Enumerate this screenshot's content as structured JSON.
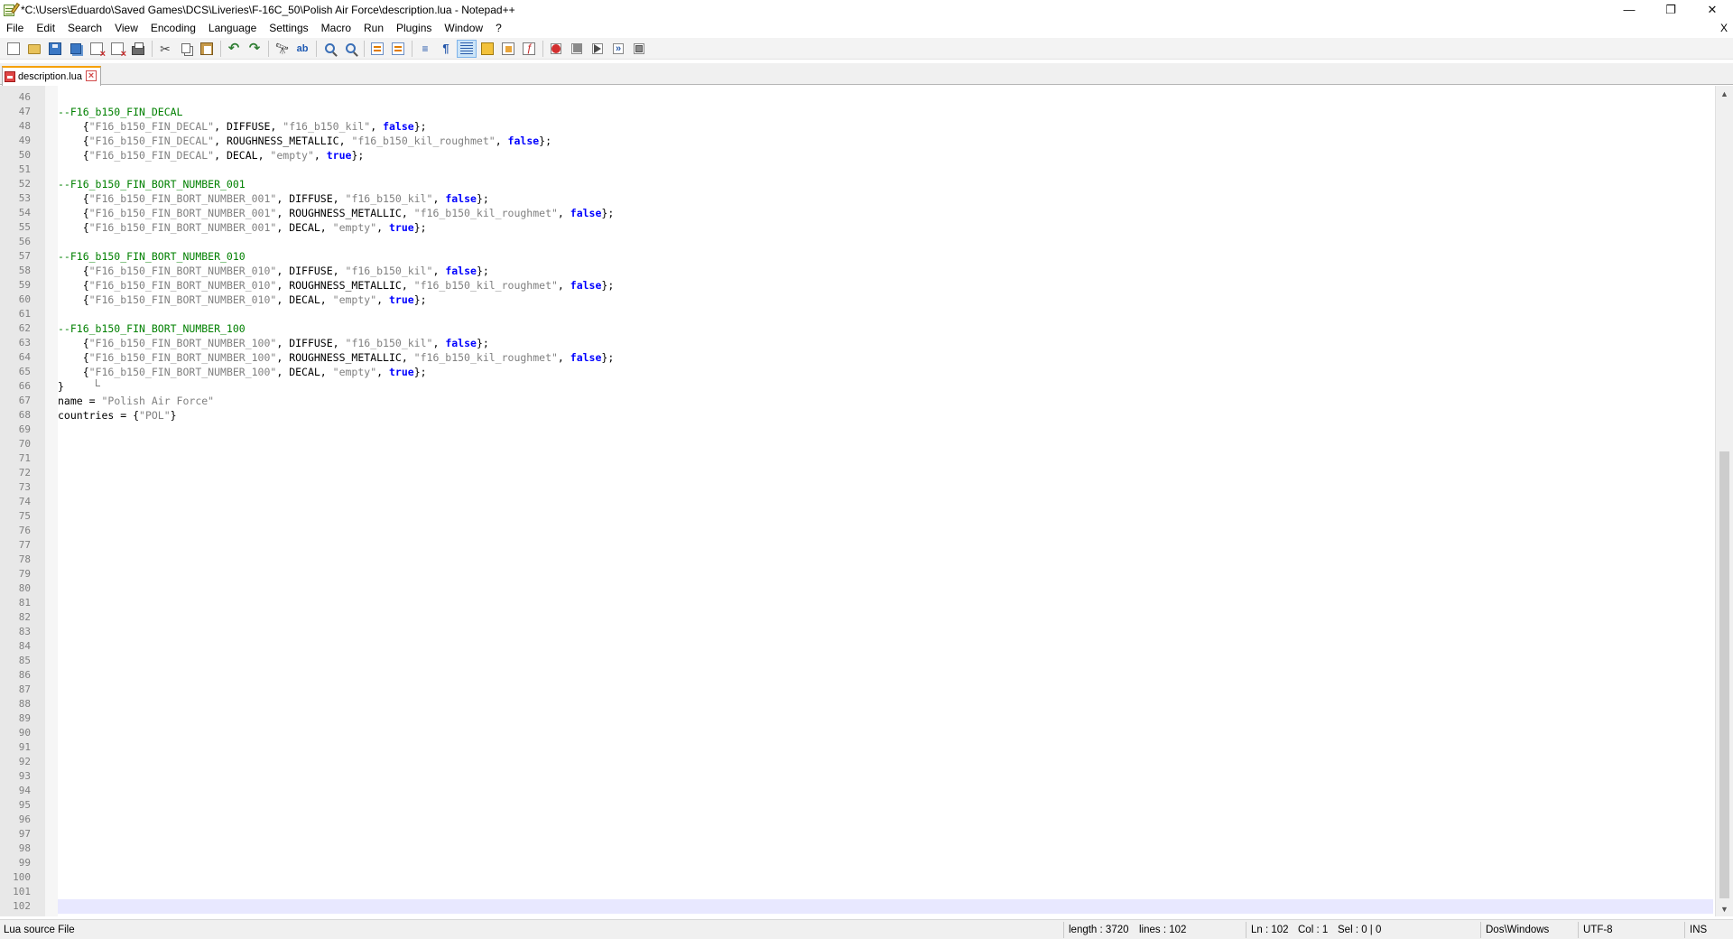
{
  "window": {
    "title": "*C:\\Users\\Eduardo\\Saved Games\\DCS\\Liveries\\F-16C_50\\Polish Air Force\\description.lua - Notepad++",
    "minimize": "—",
    "maximize": "❐",
    "close": "✕"
  },
  "menu": {
    "items": [
      "File",
      "Edit",
      "Search",
      "View",
      "Encoding",
      "Language",
      "Settings",
      "Macro",
      "Run",
      "Plugins",
      "Window",
      "?"
    ],
    "close_doc": "X"
  },
  "toolbar": {
    "buttons": [
      {
        "icon": "new-file-icon"
      },
      {
        "icon": "open-file-icon"
      },
      {
        "icon": "save-icon"
      },
      {
        "icon": "save-all-icon"
      },
      {
        "icon": "close-file-icon"
      },
      {
        "icon": "close-all-icon"
      },
      {
        "icon": "print-icon"
      },
      {
        "icon": "cut-icon"
      },
      {
        "icon": "copy-icon"
      },
      {
        "icon": "paste-icon"
      },
      {
        "icon": "undo-icon"
      },
      {
        "icon": "redo-icon"
      },
      {
        "icon": "find-icon"
      },
      {
        "icon": "replace-icon"
      },
      {
        "icon": "zoom-in-icon"
      },
      {
        "icon": "zoom-out-icon"
      },
      {
        "icon": "sync-vertical-icon"
      },
      {
        "icon": "sync-horizontal-icon"
      },
      {
        "icon": "word-wrap-icon"
      },
      {
        "icon": "show-all-chars-icon"
      },
      {
        "icon": "indent-guide-icon"
      },
      {
        "icon": "user-language-icon"
      },
      {
        "icon": "document-map-icon"
      },
      {
        "icon": "function-list-icon"
      },
      {
        "icon": "record-macro-icon"
      },
      {
        "icon": "stop-macro-icon"
      },
      {
        "icon": "play-macro-icon"
      },
      {
        "icon": "run-macro-multiple-icon"
      },
      {
        "icon": "save-macro-icon"
      }
    ],
    "active_button": "indent-guide-icon"
  },
  "tabs": [
    {
      "label": "description.lua",
      "modified": true,
      "active": true
    }
  ],
  "editor": {
    "language": "lua",
    "current_line": 102,
    "lines": [
      {
        "n": 46,
        "tokens": []
      },
      {
        "n": 47,
        "tokens": [
          [
            "c",
            "--F16_b150_FIN_DECAL"
          ]
        ]
      },
      {
        "n": 48,
        "tokens": [
          [
            "p",
            "    {"
          ],
          [
            "s",
            "\"F16_b150_FIN_DECAL\""
          ],
          [
            "p",
            ", DIFFUSE, "
          ],
          [
            "s",
            "\"f16_b150_kil\""
          ],
          [
            "p",
            ", "
          ],
          [
            "k",
            "false"
          ],
          [
            "p",
            "};"
          ]
        ]
      },
      {
        "n": 49,
        "tokens": [
          [
            "p",
            "    {"
          ],
          [
            "s",
            "\"F16_b150_FIN_DECAL\""
          ],
          [
            "p",
            ", ROUGHNESS_METALLIC, "
          ],
          [
            "s",
            "\"f16_b150_kil_roughmet\""
          ],
          [
            "p",
            ", "
          ],
          [
            "k",
            "false"
          ],
          [
            "p",
            "};"
          ]
        ]
      },
      {
        "n": 50,
        "tokens": [
          [
            "p",
            "    {"
          ],
          [
            "s",
            "\"F16_b150_FIN_DECAL\""
          ],
          [
            "p",
            ", DECAL, "
          ],
          [
            "s",
            "\"empty\""
          ],
          [
            "p",
            ", "
          ],
          [
            "k",
            "true"
          ],
          [
            "p",
            "};"
          ]
        ]
      },
      {
        "n": 51,
        "tokens": []
      },
      {
        "n": 52,
        "tokens": [
          [
            "c",
            "--F16_b150_FIN_BORT_NUMBER_001"
          ]
        ]
      },
      {
        "n": 53,
        "tokens": [
          [
            "p",
            "    {"
          ],
          [
            "s",
            "\"F16_b150_FIN_BORT_NUMBER_001\""
          ],
          [
            "p",
            ", DIFFUSE, "
          ],
          [
            "s",
            "\"f16_b150_kil\""
          ],
          [
            "p",
            ", "
          ],
          [
            "k",
            "false"
          ],
          [
            "p",
            "};"
          ]
        ]
      },
      {
        "n": 54,
        "tokens": [
          [
            "p",
            "    {"
          ],
          [
            "s",
            "\"F16_b150_FIN_BORT_NUMBER_001\""
          ],
          [
            "p",
            ", ROUGHNESS_METALLIC, "
          ],
          [
            "s",
            "\"f16_b150_kil_roughmet\""
          ],
          [
            "p",
            ", "
          ],
          [
            "k",
            "false"
          ],
          [
            "p",
            "};"
          ]
        ]
      },
      {
        "n": 55,
        "tokens": [
          [
            "p",
            "    {"
          ],
          [
            "s",
            "\"F16_b150_FIN_BORT_NUMBER_001\""
          ],
          [
            "p",
            ", DECAL, "
          ],
          [
            "s",
            "\"empty\""
          ],
          [
            "p",
            ", "
          ],
          [
            "k",
            "true"
          ],
          [
            "p",
            "};"
          ]
        ]
      },
      {
        "n": 56,
        "tokens": []
      },
      {
        "n": 57,
        "tokens": [
          [
            "c",
            "--F16_b150_FIN_BORT_NUMBER_010"
          ]
        ]
      },
      {
        "n": 58,
        "tokens": [
          [
            "p",
            "    {"
          ],
          [
            "s",
            "\"F16_b150_FIN_BORT_NUMBER_010\""
          ],
          [
            "p",
            ", DIFFUSE, "
          ],
          [
            "s",
            "\"f16_b150_kil\""
          ],
          [
            "p",
            ", "
          ],
          [
            "k",
            "false"
          ],
          [
            "p",
            "};"
          ]
        ]
      },
      {
        "n": 59,
        "tokens": [
          [
            "p",
            "    {"
          ],
          [
            "s",
            "\"F16_b150_FIN_BORT_NUMBER_010\""
          ],
          [
            "p",
            ", ROUGHNESS_METALLIC, "
          ],
          [
            "s",
            "\"f16_b150_kil_roughmet\""
          ],
          [
            "p",
            ", "
          ],
          [
            "k",
            "false"
          ],
          [
            "p",
            "};"
          ]
        ]
      },
      {
        "n": 60,
        "tokens": [
          [
            "p",
            "    {"
          ],
          [
            "s",
            "\"F16_b150_FIN_BORT_NUMBER_010\""
          ],
          [
            "p",
            ", DECAL, "
          ],
          [
            "s",
            "\"empty\""
          ],
          [
            "p",
            ", "
          ],
          [
            "k",
            "true"
          ],
          [
            "p",
            "};"
          ]
        ]
      },
      {
        "n": 61,
        "tokens": []
      },
      {
        "n": 62,
        "tokens": [
          [
            "c",
            "--F16_b150_FIN_BORT_NUMBER_100"
          ]
        ]
      },
      {
        "n": 63,
        "tokens": [
          [
            "p",
            "    {"
          ],
          [
            "s",
            "\"F16_b150_FIN_BORT_NUMBER_100\""
          ],
          [
            "p",
            ", DIFFUSE, "
          ],
          [
            "s",
            "\"f16_b150_kil\""
          ],
          [
            "p",
            ", "
          ],
          [
            "k",
            "false"
          ],
          [
            "p",
            "};"
          ]
        ]
      },
      {
        "n": 64,
        "tokens": [
          [
            "p",
            "    {"
          ],
          [
            "s",
            "\"F16_b150_FIN_BORT_NUMBER_100\""
          ],
          [
            "p",
            ", ROUGHNESS_METALLIC, "
          ],
          [
            "s",
            "\"f16_b150_kil_roughmet\""
          ],
          [
            "p",
            ", "
          ],
          [
            "k",
            "false"
          ],
          [
            "p",
            "};"
          ]
        ]
      },
      {
        "n": 65,
        "tokens": [
          [
            "p",
            "    {"
          ],
          [
            "s",
            "\"F16_b150_FIN_BORT_NUMBER_100\""
          ],
          [
            "p",
            ", DECAL, "
          ],
          [
            "s",
            "\"empty\""
          ],
          [
            "p",
            ", "
          ],
          [
            "k",
            "true"
          ],
          [
            "p",
            "};"
          ]
        ]
      },
      {
        "n": 66,
        "tokens": [
          [
            "p",
            "}"
          ]
        ]
      },
      {
        "n": 67,
        "tokens": [
          [
            "p",
            "name = "
          ],
          [
            "s",
            "\"Polish Air Force\""
          ]
        ]
      },
      {
        "n": 68,
        "tokens": [
          [
            "p",
            "countries = {"
          ],
          [
            "s",
            "\"POL\""
          ],
          [
            "p",
            "}"
          ]
        ]
      },
      {
        "n": 69,
        "tokens": []
      },
      {
        "n": 70,
        "tokens": []
      },
      {
        "n": 71,
        "tokens": []
      },
      {
        "n": 72,
        "tokens": []
      },
      {
        "n": 73,
        "tokens": []
      },
      {
        "n": 74,
        "tokens": []
      },
      {
        "n": 75,
        "tokens": []
      },
      {
        "n": 76,
        "tokens": []
      },
      {
        "n": 77,
        "tokens": []
      },
      {
        "n": 78,
        "tokens": []
      },
      {
        "n": 79,
        "tokens": []
      },
      {
        "n": 80,
        "tokens": []
      },
      {
        "n": 81,
        "tokens": []
      },
      {
        "n": 82,
        "tokens": []
      },
      {
        "n": 83,
        "tokens": []
      },
      {
        "n": 84,
        "tokens": []
      },
      {
        "n": 85,
        "tokens": []
      },
      {
        "n": 86,
        "tokens": []
      },
      {
        "n": 87,
        "tokens": []
      },
      {
        "n": 88,
        "tokens": []
      },
      {
        "n": 89,
        "tokens": []
      },
      {
        "n": 90,
        "tokens": []
      },
      {
        "n": 91,
        "tokens": []
      },
      {
        "n": 92,
        "tokens": []
      },
      {
        "n": 93,
        "tokens": []
      },
      {
        "n": 94,
        "tokens": []
      },
      {
        "n": 95,
        "tokens": []
      },
      {
        "n": 96,
        "tokens": []
      },
      {
        "n": 97,
        "tokens": []
      },
      {
        "n": 98,
        "tokens": []
      },
      {
        "n": 99,
        "tokens": []
      },
      {
        "n": 100,
        "tokens": []
      },
      {
        "n": 101,
        "tokens": []
      },
      {
        "n": 102,
        "tokens": []
      }
    ],
    "colors": {
      "comment": "#008000",
      "string": "#808080",
      "keyword": "#0000ff",
      "plain": "#000000",
      "current_line_bg": "#e8e8ff",
      "tab_accent": "#f6a000"
    }
  },
  "scrollbar": {
    "up": "▲",
    "down": "▼"
  },
  "status": {
    "file_type": "Lua source File",
    "length": "length : 3720",
    "lines": "lines : 102",
    "ln": "Ln : 102",
    "col": "Col : 1",
    "sel": "Sel : 0 | 0",
    "eol": "Dos\\Windows",
    "encoding": "UTF-8",
    "mode": "INS"
  }
}
